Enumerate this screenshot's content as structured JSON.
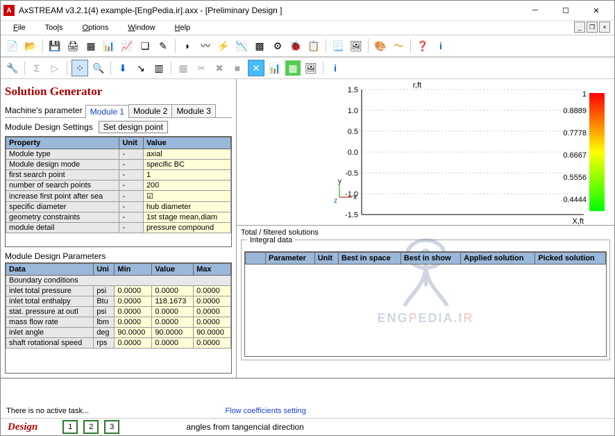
{
  "title": "AxSTREAM  v3.2.1(4)    example-[EngPedia.ir].axx - [Preliminary Design   ]",
  "menus": [
    "File",
    "Tools",
    "Options",
    "Window",
    "Help"
  ],
  "solgen": "Solution Generator",
  "tabs_label_prefix": "Machine's parameter",
  "tabs": [
    "Module 1",
    "Module 2",
    "Module 3"
  ],
  "active_tab": 0,
  "subheader": "Module Design Settings",
  "set_point_btn": "Set design point",
  "grid1": {
    "headers": [
      "Property",
      "Unit",
      "Value"
    ],
    "rows": [
      [
        "Module type",
        "-",
        "axial"
      ],
      [
        "Module design mode",
        "-",
        "specific BC"
      ],
      [
        "first search point",
        "-",
        "1"
      ],
      [
        "number of search points",
        "-",
        "200"
      ],
      [
        "increase first point after sea",
        "-",
        "☑"
      ],
      [
        "specific diameter",
        "-",
        "hub diameter"
      ],
      [
        "geometry constraints",
        "-",
        "1st stage mean,diam"
      ],
      [
        "module detail",
        "-",
        "pressure compound"
      ]
    ]
  },
  "params_label": "Module Design Parameters",
  "grid2": {
    "headers": [
      "Data",
      "Uni",
      "Min",
      "Value",
      "Max"
    ],
    "rows": [
      [
        "Boundary conditions",
        "",
        "",
        "",
        ""
      ],
      [
        "inlet total pressure",
        "psi",
        "0.0000",
        "0.0000",
        "0.0000"
      ],
      [
        "inlet total enthalpy",
        "Btu",
        "0.0000",
        "118.1673",
        "0.0000"
      ],
      [
        "stat. pressure at outl",
        "psi",
        "0.0000",
        "0.0000",
        "0.0000"
      ],
      [
        "mass flow rate",
        "lbm",
        "0.0000",
        "0.0000",
        "0.0000"
      ],
      [
        "inlet angle",
        "deg",
        "90.0000",
        "90.0000",
        "90.0000"
      ],
      [
        "shaft rotational speed",
        "rps",
        "0.0000",
        "0.0000",
        "0.0000"
      ]
    ]
  },
  "chart_data": {
    "type": "scatter",
    "title": "r,ft",
    "xlabel": "X,ft",
    "ylabel": "",
    "yticks": [
      1.5,
      1.0,
      0.5,
      0.0,
      -0.5,
      -1.0,
      -1.5
    ],
    "xlim": [
      0,
      1
    ],
    "ylim": [
      -1.5,
      1.5
    ],
    "series": []
  },
  "colorbar": {
    "max": "1",
    "ticks": [
      "0.8889",
      "0.7778",
      "0.6667",
      "0.5556",
      "0.4444"
    ]
  },
  "solutions_header": "Total /  filtered solutions",
  "integral_label": "Integral data",
  "sol_cols": [
    "Parameter",
    "Unit",
    "Best in space",
    "Best in show",
    "Applied solution",
    "Picked solution"
  ],
  "watermark": "ENGPEDIA.IR",
  "no_task": "There is no active task...",
  "flow_link": "Flow coefficients setting",
  "design_label": "Design",
  "numboxes": [
    "1",
    "2",
    "3"
  ],
  "angles_note": "angles from tangencial direction"
}
